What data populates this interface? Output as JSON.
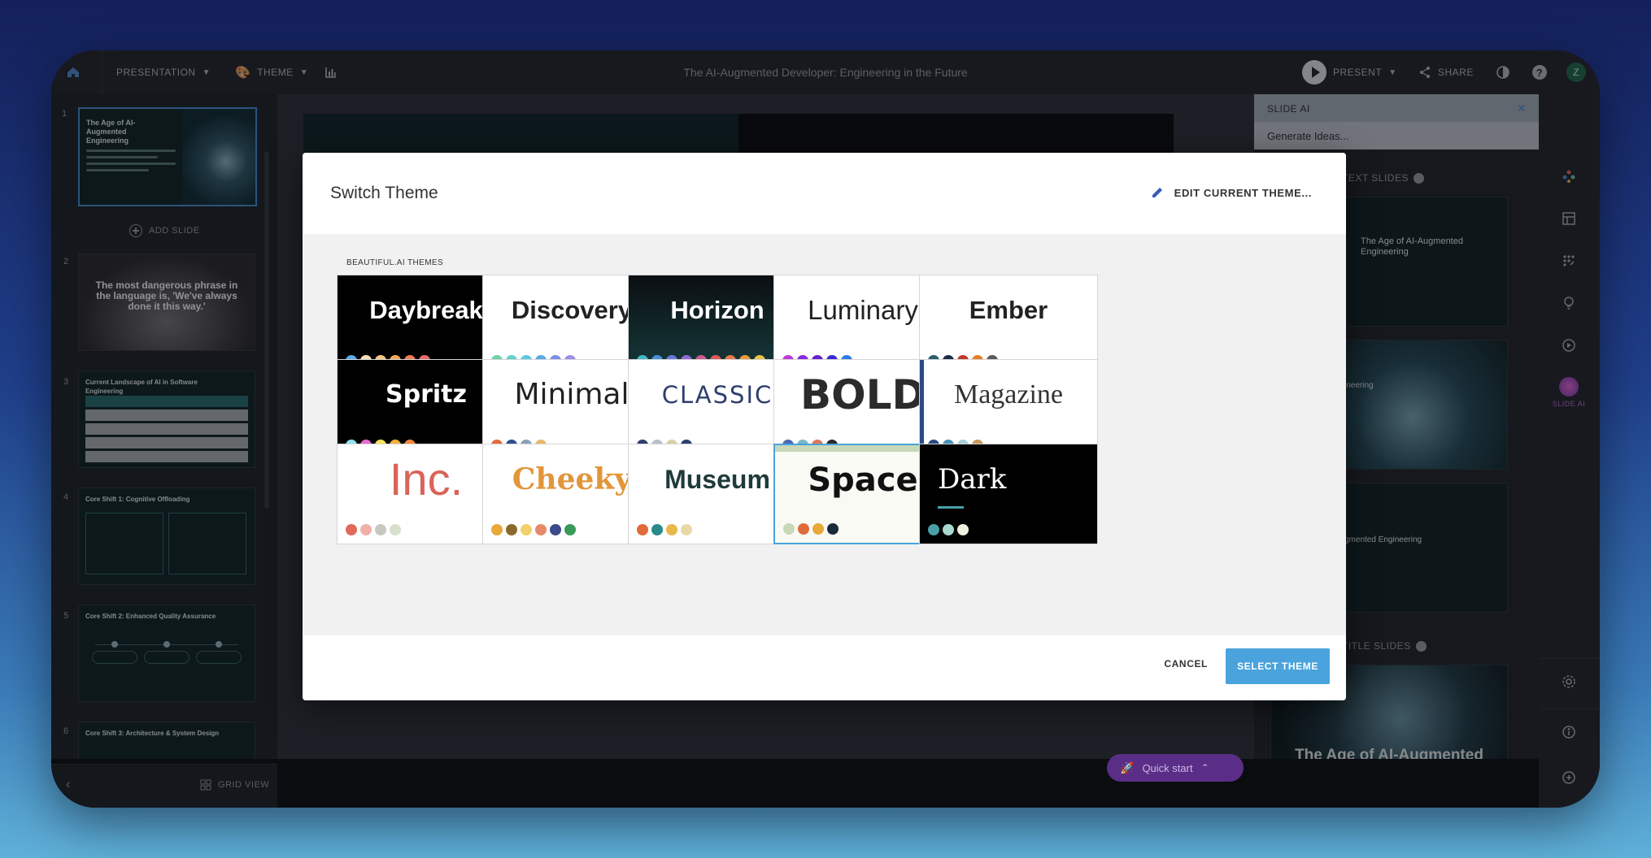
{
  "app": {
    "topbar": {
      "presentation_label": "PRESENTATION",
      "theme_label": "THEME",
      "doc_title": "The AI-Augmented Developer: Engineering in the Future",
      "present_label": "PRESENT",
      "share_label": "SHARE",
      "avatar_initial": "Z"
    },
    "slides": [
      {
        "num": "1",
        "title": "The Age of AI-Augmented Engineering",
        "selected": true
      },
      {
        "num": "2",
        "quote": "The most dangerous phrase in the language is, 'We've always done it this way.'"
      },
      {
        "num": "3",
        "title": "Current Landscape of AI in Software Engineering"
      },
      {
        "num": "4",
        "title": "Core Shift 1: Cognitive Offloading"
      },
      {
        "num": "5",
        "title": "Core Shift 2: Enhanced Quality Assurance"
      },
      {
        "num": "6",
        "title": "Core Shift 3: Architecture & System Design"
      }
    ],
    "add_slide_label": "ADD SLIDE",
    "grid_view_label": "GRID VIEW",
    "quick_start_label": "Quick start",
    "slide_ai": {
      "header": "SLIDE AI",
      "generate": "Generate Ideas...",
      "text_slides_label": "TEXT SLIDES",
      "title_slides_label": "TITLE SLIDES",
      "text_slide_title": "The Age of AI-Augmented Engineering",
      "thumb2_partial": "ineering",
      "thumb3_partial": "gmented Engineering",
      "title_slide_title": "The Age of AI-Augmented Engineering"
    },
    "rail": {
      "slide_ai_label": "SLIDE AI"
    }
  },
  "modal": {
    "title": "Switch Theme",
    "edit_label": "EDIT CURRENT THEME...",
    "section_label": "BEAUTIFUL.AI THEMES",
    "themes": [
      {
        "name": "Daybreak",
        "bg": "#000000",
        "fg": "#ffffff",
        "palette": [
          "#5aa9e6",
          "#f7e0b5",
          "#f5c583",
          "#f2a65a",
          "#ef7d57",
          "#e86a6a"
        ]
      },
      {
        "name": "Discovery",
        "bg": "#ffffff",
        "fg": "#222222",
        "palette": [
          "#6fd3a8",
          "#66d1c9",
          "#5cc8e0",
          "#5aa9e6",
          "#7b8fe8",
          "#9c8ce6"
        ]
      },
      {
        "name": "Horizon",
        "bg": "#0e2a2c",
        "fg": "#ffffff",
        "palette": [
          "#3fb8c4",
          "#4a90d9",
          "#6a79d8",
          "#8e6bd0",
          "#c95b8c",
          "#e25a5a",
          "#e7794a",
          "#e89a3d",
          "#e8c34a"
        ]
      },
      {
        "name": "Luminary",
        "bg": "#ffffff",
        "fg": "#222222",
        "palette": [
          "#c03ad8",
          "#8a2be2",
          "#6a1fd1",
          "#3a2bd1",
          "#2f7be8"
        ]
      },
      {
        "name": "Ember",
        "bg": "#ffffff",
        "fg": "#222222",
        "palette": [
          "#2b5e6b",
          "#1d2b4a",
          "#c0392b",
          "#e67e22",
          "#5b5b5b"
        ]
      },
      {
        "name": "Spritz",
        "bg": "#000000",
        "fg": "#ffffff",
        "palette": [
          "#8fe3ef",
          "#e86ad1",
          "#f6e35a",
          "#f0b13a",
          "#f08a3a"
        ]
      },
      {
        "name": "Minimal",
        "bg": "#ffffff",
        "fg": "#222222",
        "palette": [
          "#e36a3a",
          "#2f4f8f",
          "#8aa0b5",
          "#e9b86a"
        ]
      },
      {
        "name": "CLASSIC",
        "bg": "#ffffff",
        "fg": "#2e3e6e",
        "palette": [
          "#2e3e6e",
          "#b8bfc8",
          "#d6d1a8",
          "#2e3e6e"
        ]
      },
      {
        "name": "BOLD",
        "bg": "#ffffff",
        "fg": "#2b2b2b",
        "palette": [
          "#4a6ab0",
          "#7bb8c8",
          "#e0785a",
          "#2b2b2b"
        ]
      },
      {
        "name": "Magazine",
        "bg": "#ffffff",
        "fg": "#333333",
        "palette": [
          "#2b4a8a",
          "#4a90b8",
          "#a8d0d8",
          "#c89a5a"
        ]
      },
      {
        "name": "Inc.",
        "bg": "#ffffff",
        "fg": "#d9645a",
        "palette": [
          "#e06a5a",
          "#f0b0a8",
          "#c8c8c0",
          "#d8e0cc"
        ]
      },
      {
        "name": "Cheeky",
        "bg": "#ffffff",
        "fg": "#e2963a",
        "palette": [
          "#e8a83a",
          "#8a6a2a",
          "#f2d06a",
          "#e88a6a",
          "#3a4a8a",
          "#3a9a5a"
        ]
      },
      {
        "name": "Museum",
        "bg": "#ffffff",
        "fg": "#1f3a3a",
        "palette": [
          "#e06a3a",
          "#2a8a8a",
          "#e8b84a",
          "#e8d8a8"
        ]
      },
      {
        "name": "Space",
        "bg": "#fafaf5",
        "fg": "#111111",
        "palette": [
          "#c8d8b8",
          "#e06a3a",
          "#e8a83a",
          "#1a2a3a"
        ],
        "selected": true
      },
      {
        "name": "Dark",
        "bg": "#000000",
        "fg": "#ffffff",
        "palette": [
          "#4aa0a8",
          "#a8d8d0",
          "#f0f0e0"
        ]
      }
    ],
    "cancel_label": "CANCEL",
    "select_label": "SELECT THEME"
  }
}
